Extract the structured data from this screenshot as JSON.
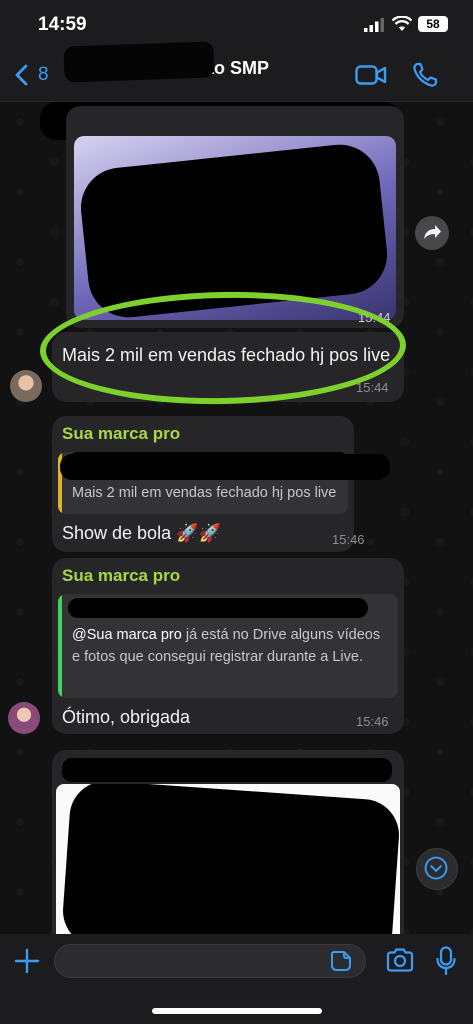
{
  "status_bar": {
    "time": "14:59",
    "battery": "58"
  },
  "header": {
    "back_count": "8",
    "title": "r - Gestão SMP"
  },
  "messages": [
    {
      "time": "15:44"
    },
    {
      "text": "Mais 2 mil em vendas fechado hj pos live",
      "time": "15:44"
    },
    {
      "sender": "Sua marca pro",
      "quote": "Mais 2 mil em vendas fechado hj pos live",
      "text": "Show de bola 🚀🚀",
      "time": "15:46"
    },
    {
      "sender": "Sua marca pro",
      "quote_mention": "@Sua marca pro",
      "quote": " já está no Drive alguns vídeos e fotos que consegui registrar durante a Live.",
      "text": "Ótimo, obrigada",
      "time": "15:46"
    }
  ],
  "input": {
    "placeholder": ""
  },
  "colors": {
    "accent": "#3b9cf5",
    "sender": "#a6d846",
    "highlight_circle": "#7ed12c"
  },
  "icons": [
    "back-icon",
    "video-icon",
    "phone-icon",
    "forward-icon",
    "chevron-down-icon",
    "plus-icon",
    "sticker-icon",
    "camera-icon",
    "mic-icon"
  ]
}
